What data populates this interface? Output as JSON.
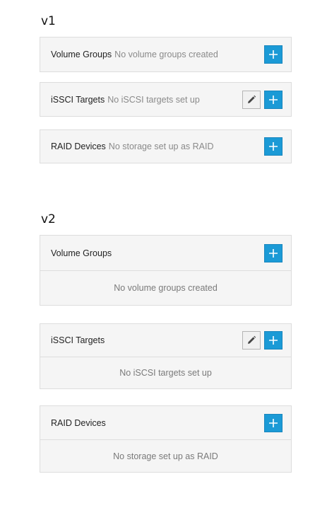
{
  "v1": {
    "heading": "v1",
    "volume_groups": {
      "title": "Volume Groups",
      "empty_text": "No volume groups created"
    },
    "iscsi_targets": {
      "title": "iSSCI Targets",
      "empty_text": "No iSCSI targets set up"
    },
    "raid_devices": {
      "title": "RAID Devices",
      "empty_text": "No storage set up as RAID"
    }
  },
  "v2": {
    "heading": "v2",
    "volume_groups": {
      "title": "Volume Groups",
      "empty_text": "No volume groups created"
    },
    "iscsi_targets": {
      "title": "iSSCI Targets",
      "empty_text": "No iSCSI targets set up"
    },
    "raid_devices": {
      "title": "RAID Devices",
      "empty_text": "No storage set up as RAID"
    }
  },
  "icons": {
    "add": "plus-icon",
    "edit": "pencil-icon"
  },
  "colors": {
    "add_button": "#1b9ad6",
    "panel_bg": "#f5f5f5",
    "panel_border": "#dddddd",
    "muted_text": "#8a8a8a"
  }
}
